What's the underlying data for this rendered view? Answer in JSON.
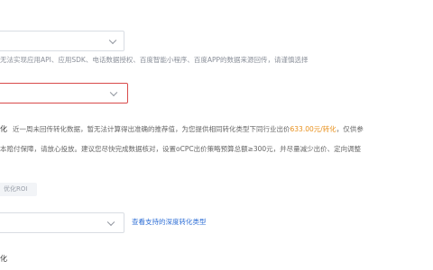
{
  "field1": {
    "hint": "无法实现应用API、应用SDK、电话数据授权、百度智能小程序、百度APP的数据来源回传，请谨慎选择"
  },
  "field2": {
    "error": true
  },
  "info": {
    "line1_label": "化",
    "line1_a": "近一周未回传转化数据，暂无法计算得出准确的推荐值，",
    "line1_b": "为您提供相同转化类型下同行业出价",
    "line1_price": "633.00元/转化",
    "line1_c": "，仅供参",
    "line2": "本赔付保障，请放心投放。建议您尽快完成数据核对，设置oCPC出价策略预算总额≥300元，并尽量减少出价、定向调整"
  },
  "roi_pill": {
    "label": "优化ROI"
  },
  "field3": {
    "value": "",
    "link": "查看支持的深度转化类型"
  },
  "bottom_label": "化",
  "colors": {
    "error_border": "#d84a4a",
    "accent": "#e8901c",
    "link": "#2f6fd6"
  }
}
